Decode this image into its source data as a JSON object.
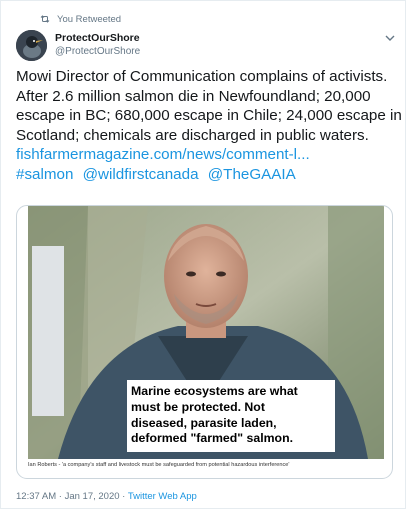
{
  "retweet": {
    "label": "You Retweeted"
  },
  "author": {
    "name": "ProtectOurShore",
    "handle": "@ProtectOurShore"
  },
  "tweet": {
    "lines": [
      "Mowi Director of Communication complains of activists.",
      "After 2.6 million salmon die in Newfoundland; 20,000",
      "escape in BC; 680,000 escape in Chile; 24,000 escape in",
      "Scotland; chemicals are discharged in public waters."
    ],
    "link": "fishfarmermagazine.com/news/comment-l...",
    "hashtags": [
      "#salmon",
      "@wildfirstcanada",
      "@TheGAAIA"
    ]
  },
  "media": {
    "overlay_text": "Marine ecosystems are what\nmust be protected. Not\ndiseased, parasite laden,\ndeformed \"farmed\" salmon.",
    "caption": "Ian Roberts - 'a company's staff and livestock must be safeguarded from potential hazardous interference'"
  },
  "meta": {
    "time": "12:37 AM",
    "separator": " · ",
    "date": "Jan 17, 2020",
    "source": "Twitter Web App"
  },
  "icons": {
    "retweet": "retweet-icon",
    "caret": "chevron-down-icon",
    "avatar": "bird-avatar"
  },
  "colors": {
    "link": "#1b95e0",
    "secondary": "#657786",
    "text": "#14171a"
  }
}
